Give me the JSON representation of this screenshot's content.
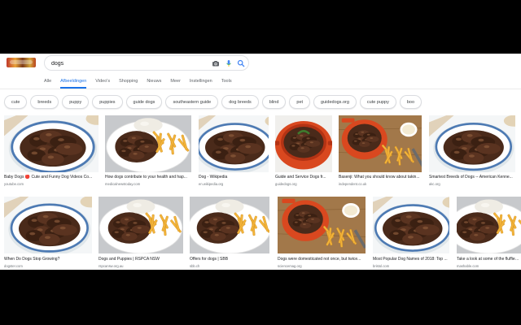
{
  "search": {
    "query": "dogs"
  },
  "tabs": [
    {
      "label": "Alle"
    },
    {
      "label": "Afbeeldingen",
      "active": true
    },
    {
      "label": "Video's"
    },
    {
      "label": "Shopping"
    },
    {
      "label": "Nieuws"
    },
    {
      "label": "Meer"
    },
    {
      "label": "Instellingen"
    },
    {
      "label": "Tools"
    }
  ],
  "chips": [
    "cute",
    "breeds",
    "puppy",
    "puppies",
    "guide dogs",
    "southeastern guide",
    "dog breeds",
    "blind",
    "pet",
    "guidedogs.org",
    "cute puppy",
    "boo"
  ],
  "results": [
    {
      "caption": "Baby Dogs 🔴 Cute and Funny Dog Videos Co...",
      "source": "youtube.com",
      "image": "stew-bowl"
    },
    {
      "caption": "How dogs contribute to your health and hap...",
      "source": "medicalnewstoday.com",
      "image": "stew-fries"
    },
    {
      "caption": "Dog - Wikipedia",
      "source": "en.wikipedia.org",
      "image": "stew-bowl"
    },
    {
      "caption": "Guide and Service Dogs fr...",
      "source": "guidedogs.org",
      "image": "stew-red-pot"
    },
    {
      "caption": "Basenji: What you should know about takin...",
      "source": "independent.co.uk",
      "image": "stew-board"
    },
    {
      "caption": "Smartest Breeds of Dogs -- American Kenne...",
      "source": "akc.org",
      "image": "stew-bowl"
    },
    {
      "caption": "When Do Dogs Stop Growing?",
      "source": "dogster.com",
      "image": "stew-bowl"
    },
    {
      "caption": "Dogs and Puppies | RSPCA NSW",
      "source": "rspcansw.org.au",
      "image": "stew-fries"
    },
    {
      "caption": "Offers for dogs | SBB",
      "source": "sbb.ch",
      "image": "stew-fries"
    },
    {
      "caption": "Dogs were domesticated not once, but twice...",
      "source": "sciencemag.org",
      "image": "stew-board"
    },
    {
      "caption": "Most Popular Dog Names of 2018: Top ...",
      "source": "bristol.com",
      "image": "stew-bowl"
    },
    {
      "caption": "Take a look at some of the fluffiest ...",
      "source": "mashable.com",
      "image": "stew-fries"
    }
  ],
  "colors": {
    "accent": "#1a73e8",
    "gravy": "#4a2a1a",
    "fries": "#f2b43a",
    "pot": "#d9481f",
    "board": "#a2784a"
  }
}
